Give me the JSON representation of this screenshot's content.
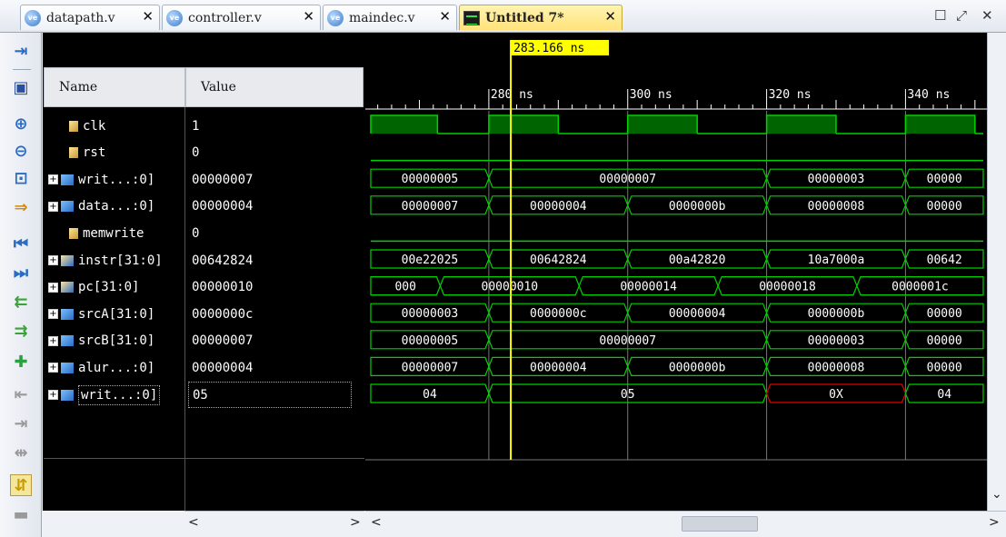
{
  "tabs": [
    {
      "label": "datapath.v",
      "icon": "verilog-file-icon"
    },
    {
      "label": "controller.v",
      "icon": "verilog-file-icon"
    },
    {
      "label": "maindec.v",
      "icon": "verilog-file-icon"
    },
    {
      "label": "Untitled 7*",
      "icon": "waveform-icon",
      "active": true
    }
  ],
  "tab_icon_text": "ve",
  "close_glyph": "✕",
  "window_controls": {
    "maximize": "☐",
    "restore": "⤢",
    "close": "✕"
  },
  "toolbar_icons": [
    "expand-to-panel-icon",
    "save-icon",
    "zoom-in-icon",
    "zoom-out-icon",
    "zoom-fit-icon",
    "goto-cursor-icon",
    "go-to-start-icon",
    "go-to-end-icon",
    "previous-transition-icon",
    "next-transition-icon",
    "add-marker-icon",
    "previous-marker-icon",
    "next-marker-icon",
    "swap-cursors-icon",
    "snap-to-transition-icon",
    "float-icon"
  ],
  "columns": {
    "name": "Name",
    "value": "Value"
  },
  "signals": [
    {
      "name": "clk",
      "value": "1",
      "kind": "bit"
    },
    {
      "name": "rst",
      "value": "0",
      "kind": "bit"
    },
    {
      "name": "writ...:0]",
      "value": "00000007",
      "kind": "bus"
    },
    {
      "name": "data...:0]",
      "value": "00000004",
      "kind": "bus"
    },
    {
      "name": "memwrite",
      "value": "0",
      "kind": "bit"
    },
    {
      "name": "instr[31:0]",
      "value": "00642824",
      "kind": "bus-y"
    },
    {
      "name": "pc[31:0]",
      "value": "00000010",
      "kind": "bus-y"
    },
    {
      "name": "srcA[31:0]",
      "value": "0000000c",
      "kind": "bus"
    },
    {
      "name": "srcB[31:0]",
      "value": "00000007",
      "kind": "bus"
    },
    {
      "name": "alur...:0]",
      "value": "00000004",
      "kind": "bus"
    },
    {
      "name": "writ...:0]",
      "value": "05",
      "kind": "bus",
      "selected": true
    }
  ],
  "cursor_time": "283.166 ns",
  "time_axis": {
    "labels": [
      "280 ns",
      "300 ns",
      "320 ns",
      "340 ns"
    ],
    "label_times_ns": [
      280,
      300,
      320,
      340
    ],
    "view_start_ns": 263.0,
    "view_end_ns": 351.2
  },
  "colors": {
    "waveform": "#00d000",
    "clock_fill": "#006400",
    "cursor": "#ffff00",
    "bus_x": "#e00000",
    "text": "#ffffff"
  },
  "waveforms": [
    {
      "type": "clock",
      "high_ranges_ns": [
        [
          263.0,
          272.6
        ],
        [
          280.0,
          290.0
        ],
        [
          300.0,
          310.0
        ],
        [
          320.0,
          330.0
        ],
        [
          340.0,
          350.0
        ]
      ]
    },
    {
      "type": "bit",
      "level": 0
    },
    {
      "type": "bus",
      "segments": [
        {
          "start_ns": 263.0,
          "end_ns": 280.0,
          "label": "00000005"
        },
        {
          "start_ns": 280.0,
          "end_ns": 320.0,
          "label": "00000007"
        },
        {
          "start_ns": 320.0,
          "end_ns": 340.0,
          "label": "00000003"
        },
        {
          "start_ns": 340.0,
          "end_ns": 351.2,
          "label": "00000"
        }
      ]
    },
    {
      "type": "bus",
      "segments": [
        {
          "start_ns": 263.0,
          "end_ns": 280.0,
          "label": "00000007"
        },
        {
          "start_ns": 280.0,
          "end_ns": 300.0,
          "label": "00000004"
        },
        {
          "start_ns": 300.0,
          "end_ns": 320.0,
          "label": "0000000b"
        },
        {
          "start_ns": 320.0,
          "end_ns": 340.0,
          "label": "00000008"
        },
        {
          "start_ns": 340.0,
          "end_ns": 351.2,
          "label": "00000"
        }
      ]
    },
    {
      "type": "bit",
      "level": 0
    },
    {
      "type": "bus",
      "segments": [
        {
          "start_ns": 263.0,
          "end_ns": 280.0,
          "label": "00e22025"
        },
        {
          "start_ns": 280.0,
          "end_ns": 300.0,
          "label": "00642824"
        },
        {
          "start_ns": 300.0,
          "end_ns": 320.0,
          "label": "00a42820"
        },
        {
          "start_ns": 320.0,
          "end_ns": 340.0,
          "label": "10a7000a"
        },
        {
          "start_ns": 340.0,
          "end_ns": 351.2,
          "label": "00642"
        }
      ]
    },
    {
      "type": "bus",
      "segments": [
        {
          "start_ns": 263.0,
          "end_ns": 273.0,
          "label": "000"
        },
        {
          "start_ns": 273.0,
          "end_ns": 293.0,
          "label": "00000010"
        },
        {
          "start_ns": 293.0,
          "end_ns": 313.0,
          "label": "00000014"
        },
        {
          "start_ns": 313.0,
          "end_ns": 333.0,
          "label": "00000018"
        },
        {
          "start_ns": 333.0,
          "end_ns": 351.2,
          "label": "0000001c"
        }
      ]
    },
    {
      "type": "bus",
      "segments": [
        {
          "start_ns": 263.0,
          "end_ns": 280.0,
          "label": "00000003"
        },
        {
          "start_ns": 280.0,
          "end_ns": 300.0,
          "label": "0000000c"
        },
        {
          "start_ns": 300.0,
          "end_ns": 320.0,
          "label": "00000004"
        },
        {
          "start_ns": 320.0,
          "end_ns": 340.0,
          "label": "0000000b"
        },
        {
          "start_ns": 340.0,
          "end_ns": 351.2,
          "label": "00000"
        }
      ]
    },
    {
      "type": "bus",
      "segments": [
        {
          "start_ns": 263.0,
          "end_ns": 280.0,
          "label": "00000005"
        },
        {
          "start_ns": 280.0,
          "end_ns": 320.0,
          "label": "00000007"
        },
        {
          "start_ns": 320.0,
          "end_ns": 340.0,
          "label": "00000003"
        },
        {
          "start_ns": 340.0,
          "end_ns": 351.2,
          "label": "00000"
        }
      ]
    },
    {
      "type": "bus",
      "segments": [
        {
          "start_ns": 263.0,
          "end_ns": 280.0,
          "label": "00000007"
        },
        {
          "start_ns": 280.0,
          "end_ns": 300.0,
          "label": "00000004"
        },
        {
          "start_ns": 300.0,
          "end_ns": 320.0,
          "label": "0000000b"
        },
        {
          "start_ns": 320.0,
          "end_ns": 340.0,
          "label": "00000008"
        },
        {
          "start_ns": 340.0,
          "end_ns": 351.2,
          "label": "00000"
        }
      ]
    },
    {
      "type": "bus",
      "segments": [
        {
          "start_ns": 263.0,
          "end_ns": 280.0,
          "label": "04"
        },
        {
          "start_ns": 280.0,
          "end_ns": 320.0,
          "label": "05"
        },
        {
          "start_ns": 320.0,
          "end_ns": 340.0,
          "label": "0X",
          "x": true
        },
        {
          "start_ns": 340.0,
          "end_ns": 351.2,
          "label": "04"
        }
      ]
    }
  ],
  "scroll_arrows": {
    "left": "<",
    "right": ">",
    "down": "⌄"
  }
}
